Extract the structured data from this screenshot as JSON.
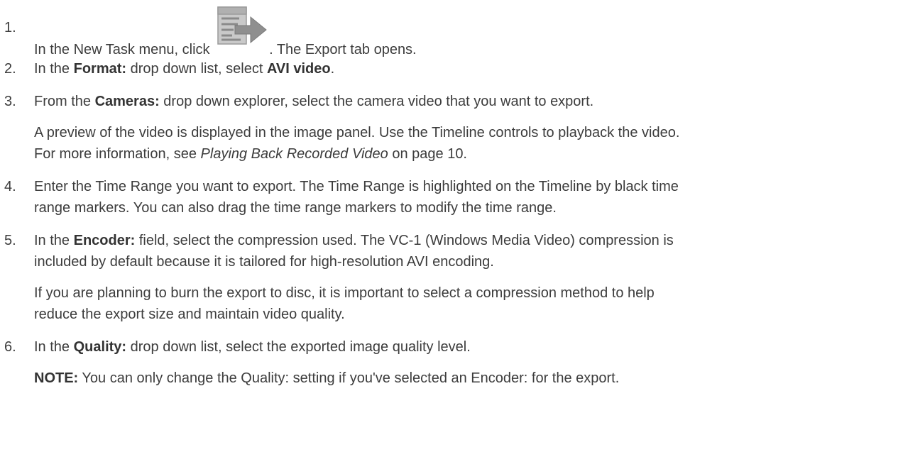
{
  "steps": [
    {
      "number": "1.",
      "before_icon": "In the New Task menu, click ",
      "icon": "export-task-icon",
      "after_icon": ". The Export tab opens."
    },
    {
      "number": "2.",
      "pre": "In the ",
      "bold1": "Format:",
      "mid": " drop down list, select ",
      "bold2": "AVI video",
      "post": "."
    },
    {
      "number": "3.",
      "pre": "From the ",
      "bold1": "Cameras:",
      "post": " drop down explorer, select the camera video that you want to export.",
      "note_line1": "A preview of the video is displayed in the image panel. Use the Timeline controls to playback the video.",
      "note_line2_pre": "For more information, see ",
      "note_line2_link": "Playing Back Recorded Video",
      "note_line2_post": " on page 10."
    },
    {
      "number": "4.",
      "line1": "Enter the Time Range you want to export. The Time Range is highlighted on the Timeline by black time",
      "line2": "range markers. You can also drag the time range markers to modify the time range."
    },
    {
      "number": "5.",
      "pre": "In the ",
      "bold1": "Encoder:",
      "post": " field, select the compression used. The VC-1 (Windows Media Video) compression is",
      "line2": "included by default because it is tailored for high-resolution AVI encoding.",
      "note_line1": "If you are planning to burn the export to disc, it is important to select a compression method to help",
      "note_line2": "reduce the export size and maintain video quality."
    },
    {
      "number": "6.",
      "pre": "In the ",
      "bold1": "Quality:",
      "post": " drop down list, select the exported image quality level.",
      "note_bold": "NOTE:",
      "note_text": " You can only change the Quality: setting if you've selected an Encoder: for the export."
    }
  ]
}
